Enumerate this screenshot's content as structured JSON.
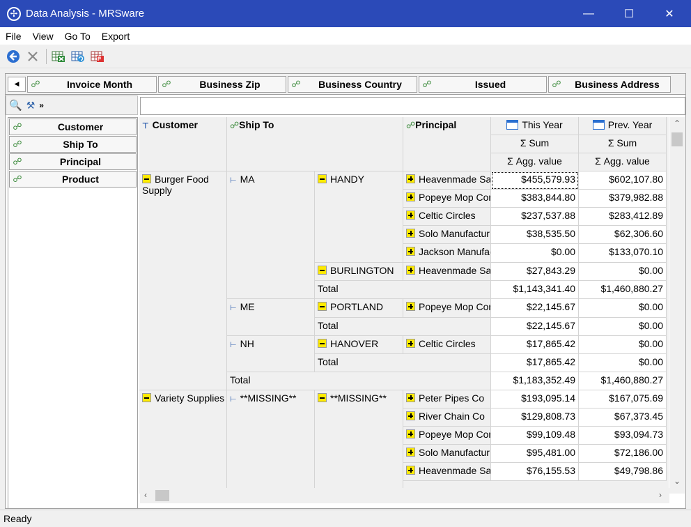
{
  "window": {
    "title": "Data Analysis - MRSware",
    "minimize": "—",
    "maximize": "☐",
    "close": "✕"
  },
  "menu": [
    "File",
    "View",
    "Go To",
    "Export"
  ],
  "filter_fields": [
    "Invoice Month",
    "Business Zip",
    "Business Country",
    "Issued",
    "Business Address"
  ],
  "row_fields": [
    "Customer",
    "Ship To",
    "Principal",
    "Product"
  ],
  "pivot": {
    "row_headers": [
      "Customer",
      "Ship To",
      "Principal"
    ],
    "columns": [
      {
        "period": "This Year",
        "agg": "Σ  Sum",
        "value": "Σ  Agg. value"
      },
      {
        "period": "Prev. Year",
        "agg": "Σ  Sum",
        "value": "Σ  Agg. value"
      }
    ],
    "customers": [
      {
        "name": "Burger Food Supply",
        "states": [
          {
            "state": "MA",
            "cities": [
              {
                "city": "HANDY",
                "rows": [
                  {
                    "principal": "Heavenmade Sa",
                    "this": "$455,579.93",
                    "prev": "$602,107.80"
                  },
                  {
                    "principal": "Popeye Mop Con",
                    "this": "$383,844.80",
                    "prev": "$379,982.88"
                  },
                  {
                    "principal": "Celtic Circles",
                    "this": "$237,537.88",
                    "prev": "$283,412.89"
                  },
                  {
                    "principal": "Solo Manufactur",
                    "this": "$38,535.50",
                    "prev": "$62,306.60"
                  },
                  {
                    "principal": "Jackson Manufac",
                    "this": "$0.00",
                    "prev": "$133,070.10"
                  }
                ]
              },
              {
                "city": "BURLINGTON",
                "rows": [
                  {
                    "principal": "Heavenmade Sa",
                    "this": "$27,843.29",
                    "prev": "$0.00"
                  }
                ]
              }
            ],
            "total": {
              "label": "Total",
              "this": "$1,143,341.40",
              "prev": "$1,460,880.27"
            }
          },
          {
            "state": "ME",
            "cities": [
              {
                "city": "PORTLAND",
                "rows": [
                  {
                    "principal": "Popeye Mop Con",
                    "this": "$22,145.67",
                    "prev": "$0.00"
                  }
                ]
              }
            ],
            "total": {
              "label": "Total",
              "this": "$22,145.67",
              "prev": "$0.00"
            }
          },
          {
            "state": "NH",
            "cities": [
              {
                "city": "HANOVER",
                "rows": [
                  {
                    "principal": "Celtic Circles",
                    "this": "$17,865.42",
                    "prev": "$0.00"
                  }
                ]
              }
            ],
            "total": {
              "label": "Total",
              "this": "$17,865.42",
              "prev": "$0.00"
            }
          }
        ],
        "total": {
          "label": "Total",
          "this": "$1,183,352.49",
          "prev": "$1,460,880.27"
        }
      },
      {
        "name": "Variety Supplies",
        "states": [
          {
            "state": "**MISSING**",
            "cities": [
              {
                "city": "**MISSING**",
                "rows": [
                  {
                    "principal": "Peter Pipes Co",
                    "this": "$193,095.14",
                    "prev": "$167,075.69"
                  },
                  {
                    "principal": "River Chain Co",
                    "this": "$129,808.73",
                    "prev": "$67,373.45"
                  },
                  {
                    "principal": "Popeye Mop Con",
                    "this": "$99,109.48",
                    "prev": "$93,094.73"
                  },
                  {
                    "principal": "Solo Manufactur",
                    "this": "$95,481.00",
                    "prev": "$72,186.00"
                  },
                  {
                    "principal": "Heavenmade Sa",
                    "this": "$76,155.53",
                    "prev": "$49,798.86"
                  }
                ]
              }
            ]
          }
        ]
      }
    ]
  },
  "status": "Ready"
}
